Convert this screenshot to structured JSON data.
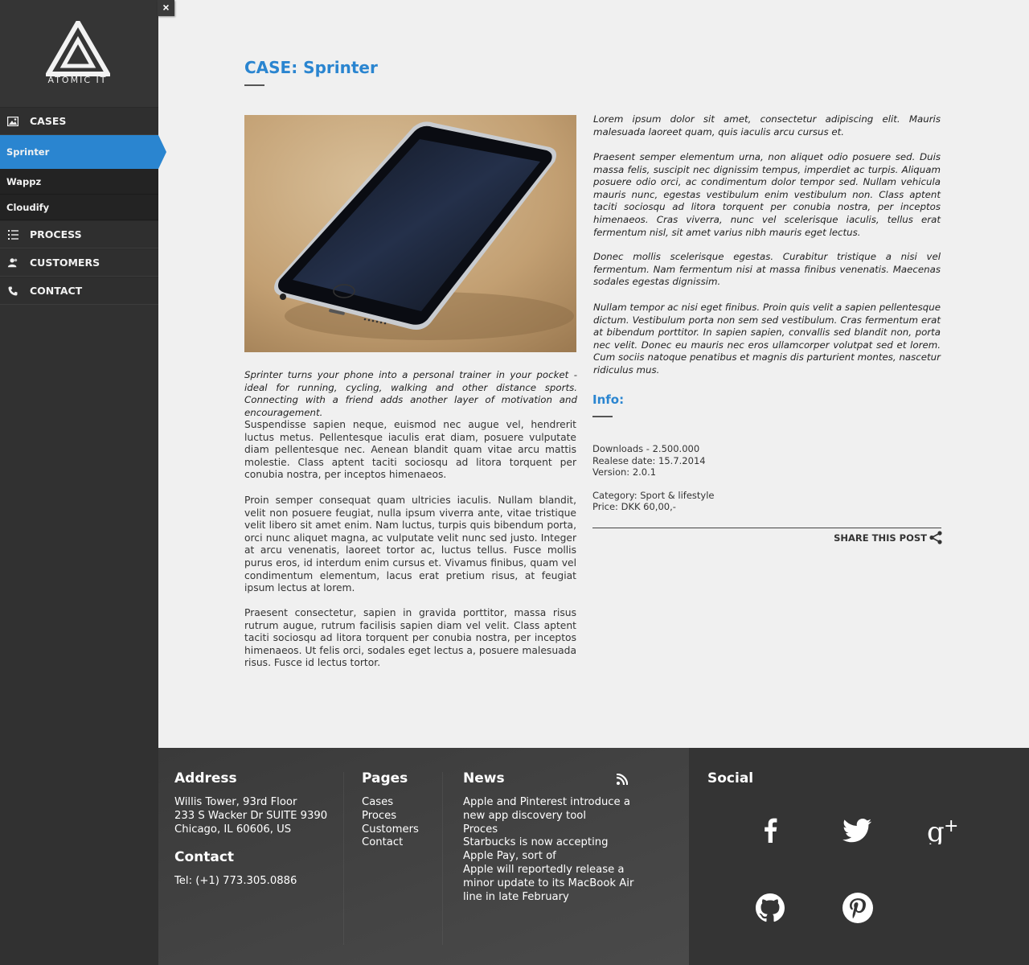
{
  "brand": {
    "logo_text": "ATOMIC IT"
  },
  "close_label": "×",
  "nav": {
    "cases": "CASES",
    "cases_items": [
      "Sprinter",
      "Wappz",
      "Cloudify"
    ],
    "process": "PROCESS",
    "customers": "CUSTOMERS",
    "contact": "CONTACT"
  },
  "case": {
    "title": "CASE: Sprinter",
    "intro": "Sprinter turns your phone into a personal trainer in your pocket - ideal for running, cycling, walking and other distance sports. Connecting with a friend adds another layer of motivation and encouragement.",
    "body": [
      "Suspendisse sapien neque, euismod nec augue vel, hendrerit luctus metus. Pellentesque iaculis erat diam, posuere vulputate diam pellentesque nec. Aenean blandit quam vitae arcu mattis molestie. Class aptent taciti sociosqu ad litora torquent per conubia nostra, per inceptos himenaeos.",
      "Proin semper consequat quam ultricies iaculis. Nullam blandit, velit non posuere feugiat, nulla ipsum viverra ante, vitae tristique velit libero sit amet enim. Nam luctus, turpis quis bibendum porta, orci nunc aliquet magna, ac vulputate velit nunc sed justo. Integer at arcu venenatis, laoreet tortor ac, luctus tellus. Fusce mollis purus eros, id interdum enim cursus et. Vivamus finibus, quam vel condimentum elementum, lacus erat pretium risus, at feugiat ipsum lectus at lorem.",
      "Praesent consectetur, sapien in gravida porttitor, massa risus rutrum augue, rutrum facilisis sapien diam vel velit. Class aptent taciti sociosqu ad litora torquent per conubia nostra, per inceptos himenaeos. Ut felis orci, sodales eget lectus a, posuere malesuada risus. Fusce id lectus tortor."
    ],
    "right": [
      "Lorem ipsum dolor sit amet, consectetur adipiscing elit. Mauris malesuada laoreet quam, quis iaculis arcu cursus et.",
      "Praesent semper elementum urna, non aliquet odio posuere sed. Duis massa felis, suscipit nec dignissim tempus, imperdiet ac turpis. Aliquam posuere odio orci, ac condimentum dolor tempor sed. Nullam vehicula mauris nunc, egestas vestibulum enim vestibulum non. Class aptent taciti sociosqu ad litora torquent per conubia nostra, per inceptos himenaeos. Cras viverra, nunc vel scelerisque iaculis, tellus erat fermentum nisl, sit amet varius nibh mauris eget lectus.",
      "Donec mollis scelerisque egestas. Curabitur tristique a nisi vel fermentum. Nam fermentum nisi at massa finibus venenatis. Maecenas sodales egestas dignissim.",
      "Nullam tempor ac nisi eget finibus. Proin quis velit a sapien pellentesque dictum. Vestibulum porta non sem sed vestibulum. Cras fermentum erat at bibendum porttitor. In sapien sapien, convallis sed blandit non, porta nec velit. Donec eu mauris nec eros ullamcorper volutpat sed et lorem. Cum sociis natoque penatibus et magnis dis parturient montes, nascetur ridiculus mus."
    ],
    "info_heading": "Info:",
    "info": {
      "downloads": "Downloads - 2.500.000",
      "release": "Realese date: 15.7.2014",
      "version": "Version: 2.0.1",
      "category": "Category: Sport & lifestyle",
      "price": "Price: DKK 60,00,-"
    },
    "share_label": "SHARE THIS POST"
  },
  "footer": {
    "address_heading": "Address",
    "address_lines": [
      "Willis Tower, 93rd Floor",
      "233 S Wacker Dr SUITE 9390",
      "Chicago, IL 60606, US"
    ],
    "contact_heading": "Contact",
    "phone": "Tel: (+1) 773.305.0886",
    "pages_heading": "Pages",
    "pages": [
      "Cases",
      "Proces",
      "Customers",
      "Contact"
    ],
    "news_heading": "News",
    "news": [
      "Apple and Pinterest introduce a new app discovery tool",
      "Proces",
      "Starbucks is now accepting Apple Pay, sort of",
      "Apple will reportedly release a minor update to its MacBook Air line in late February"
    ],
    "social_heading": "Social",
    "social_icons": [
      "facebook-icon",
      "twitter-icon",
      "google-plus-icon",
      "github-icon",
      "pinterest-icon"
    ]
  },
  "colors": {
    "accent": "#2a85d0",
    "sidebar": "#313131",
    "footer": "#444444"
  }
}
